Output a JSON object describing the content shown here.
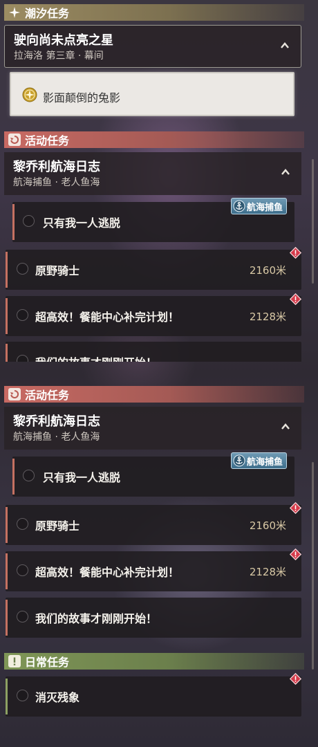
{
  "panel_top": {
    "tide_header": {
      "icon": "sparkle-icon",
      "label": "潮汐任务"
    },
    "tide_group": {
      "title": "驶向尚未点亮之星",
      "subtitle": "拉海洛 第三章 · 幕间"
    },
    "selected_quest": {
      "icon": "compass-star-icon",
      "label": "影面颠倒的兔影"
    },
    "activity_header": {
      "icon": "activity-quest-icon",
      "label": "活动任务"
    },
    "activity_group": {
      "title": "黎乔利航海日志",
      "subtitle": "航海捕鱼 · 老人鱼海"
    },
    "tag": {
      "icon": "anchor-icon",
      "label": "航海捕鱼"
    },
    "items": [
      {
        "label": "只有我一人逃脱"
      },
      {
        "label": "原野骑士",
        "distance": "2160米"
      },
      {
        "label": "超高效！餐能中心补完计划！",
        "distance": "2128米"
      },
      {
        "label": "我们的故事才刚刚开始！"
      }
    ]
  },
  "panel_bottom": {
    "activity_header": {
      "icon": "activity-quest-icon",
      "label": "活动任务"
    },
    "activity_group": {
      "title": "黎乔利航海日志",
      "subtitle": "航海捕鱼 · 老人鱼海"
    },
    "tag": {
      "icon": "anchor-icon",
      "label": "航海捕鱼"
    },
    "items": [
      {
        "label": "只有我一人逃脱"
      },
      {
        "label": "原野骑士",
        "distance": "2160米"
      },
      {
        "label": "超高效！餐能中心补完计划！",
        "distance": "2128米"
      },
      {
        "label": "我们的故事才刚刚开始！"
      }
    ],
    "daily_header": {
      "icon": "exclamation-icon",
      "label": "日常任务"
    },
    "daily_items": [
      {
        "label": "消灭残象"
      }
    ]
  },
  "colors": {
    "tide_accent": "#9c8c62",
    "activity_accent": "#c86a63",
    "daily_accent": "#7f9656",
    "distance_text": "#d9c9a6",
    "warning_red": "#d43a4a",
    "tag_blue": "#4f7f9c"
  }
}
